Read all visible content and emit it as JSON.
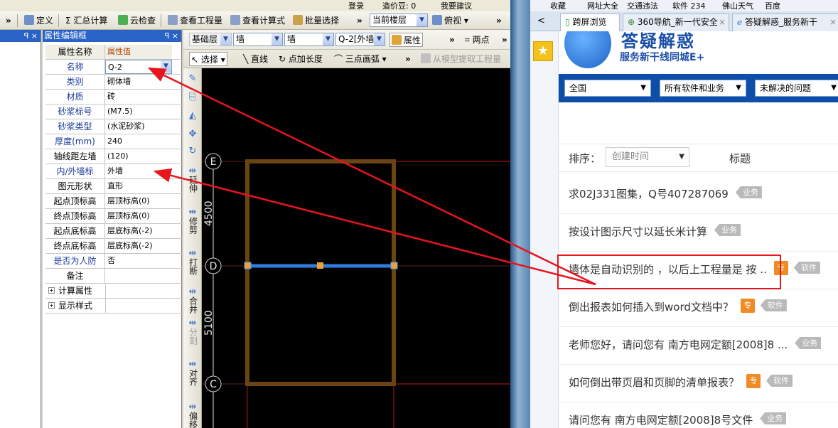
{
  "app": {
    "topstrip": {
      "login": "登录",
      "price": "造价豆: 0",
      "ask": "我要建议"
    },
    "toolbar": {
      "define": "定义",
      "summary": "汇总计算",
      "cloud_check": "云检查",
      "view_quantity": "查看工程量",
      "view_formula": "查看计算式",
      "batch_select": "批量选择",
      "floor": "当前楼层",
      "view_mode": "俯视"
    },
    "left_panel_buttons": "ꟼ ×",
    "property_panel": {
      "title": "属性编辑框",
      "header_buttons": "ꟼ ×",
      "col_name": "属性名称",
      "col_value": "属性值",
      "rows": [
        {
          "key": "名称",
          "value": "Q-2"
        },
        {
          "key": "类别",
          "value": "砌体墙"
        },
        {
          "key": "材质",
          "value": "砖"
        },
        {
          "key": "砂浆标号",
          "value": "(M7.5)"
        },
        {
          "key": "砂浆类型",
          "value": "(水泥砂浆)"
        },
        {
          "key": "厚度(mm)",
          "value": "240"
        },
        {
          "key": "轴线距左墙",
          "value": "(120)"
        },
        {
          "key": "内/外墙标",
          "value": "外墙"
        },
        {
          "key": "图元形状",
          "value": "直形"
        },
        {
          "key": "起点顶标高",
          "value": "层顶标高(0)"
        },
        {
          "key": "终点顶标高",
          "value": "层顶标高(0)"
        },
        {
          "key": "起点底标高",
          "value": "层底标高(-2)"
        },
        {
          "key": "终点底标高",
          "value": "层底标高(-2)"
        },
        {
          "key": "是否为人防",
          "value": "否"
        },
        {
          "key": "备注",
          "value": ""
        }
      ],
      "groups": [
        {
          "label": "计算属性",
          "expander": "+"
        },
        {
          "label": "显示样式",
          "expander": "+"
        }
      ]
    },
    "draw_toolbar": {
      "layer": "基础层",
      "type1": "墙",
      "type2": "墙",
      "element": "Q-2[外墙]",
      "property": "属性",
      "two_points": "两点",
      "select": "选择",
      "line": "直线",
      "point_length": "点加长度",
      "three_arc": "三点画弧",
      "extract": "从模型提取工程量"
    },
    "vertical_tools": [
      {
        "label": "延伸"
      },
      {
        "label": "修剪"
      },
      {
        "label": "打断"
      },
      {
        "label": "合并"
      },
      {
        "label": "分割"
      },
      {
        "label": "对齐"
      },
      {
        "label": "偏移"
      }
    ],
    "canvas": {
      "axes": [
        "E",
        "D",
        "C"
      ],
      "dimensions": [
        "4500",
        "5100"
      ]
    }
  },
  "browser": {
    "bookmarks": [
      "收藏",
      "网址大全",
      "交通违法",
      "软件 234",
      "佛山天气",
      "百度"
    ],
    "tabs": [
      {
        "label": "跨屏浏览"
      },
      {
        "label": "360导航_新一代安全",
        "close": "×"
      },
      {
        "label": "答疑解惑_服务新干",
        "close": "×"
      }
    ],
    "back": "<",
    "site": {
      "title": "答疑解惑",
      "subtitle": "服务新干线同城E+",
      "filters": [
        "全国",
        "所有软件和业务",
        "未解决的问题"
      ],
      "sort_label": "排序：",
      "sort_value": "创建时间",
      "column_title": "标题",
      "questions": [
        {
          "text": "求02J331图集，Q号407287069",
          "zhuan": "",
          "category": "业务"
        },
        {
          "text": "按设计图示尺寸以延长米计算",
          "zhuan": "",
          "category": "业务"
        },
        {
          "text": "墙体是自动识别的 ，以后上工程量是 按 ..",
          "zhuan": "专",
          "category": "软件"
        },
        {
          "text": "倒出报表如何插入到word文档中？",
          "zhuan": "专",
          "category": "软件"
        },
        {
          "text": "老师您好，请问您有 南方电网定额[2008]8 ...",
          "zhuan": "",
          "category": "业务"
        },
        {
          "text": "如何倒出带页眉和页脚的清单报表？",
          "zhuan": "专",
          "category": "软件"
        },
        {
          "text": "请问您有 南方电网定额[2008]8号文件",
          "zhuan": "",
          "category": "业务"
        }
      ]
    }
  },
  "colors": {
    "annotation": "#e8141e",
    "wall": "#6b4413",
    "canvas": "#000000",
    "brand": "#0d4ea8"
  }
}
